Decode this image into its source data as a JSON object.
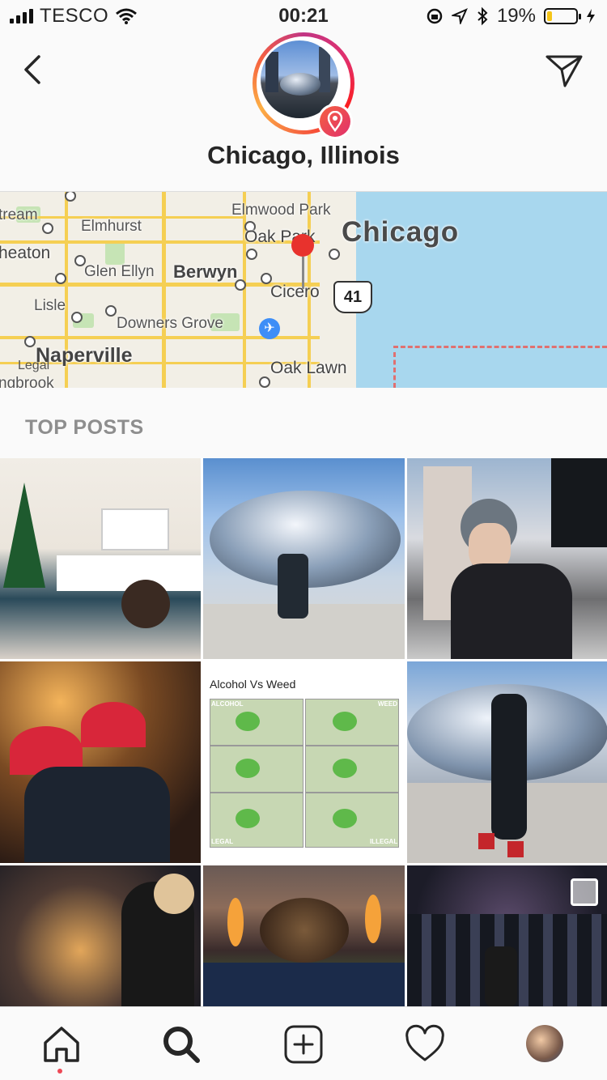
{
  "status_bar": {
    "carrier": "TESCO",
    "time": "00:21",
    "battery_percent": "19%",
    "battery_level": 0.19,
    "icons": [
      "signal-icon",
      "wifi-icon",
      "rotation-lock-icon",
      "location-arrow-icon",
      "bluetooth-icon",
      "battery-icon",
      "charging-icon"
    ]
  },
  "header": {
    "title": "Chicago, Illinois",
    "icons": [
      "back-chevron-icon",
      "send-direct-icon",
      "location-pin-icon"
    ]
  },
  "map": {
    "labels": {
      "city": "Chicago",
      "stream": "tream",
      "elmhurst": "Elmhurst",
      "elmwood_park": "Elmwood Park",
      "oak_park": "Oak Park",
      "wheaton": "heaton",
      "glen_ellyn": "Glen Ellyn",
      "berwyn": "Berwyn",
      "cicero": "Cicero",
      "lisle": "Lisle",
      "downers_grove": "Downers Grove",
      "naperville": "Naperville",
      "oak_lawn": "Oak Lawn",
      "bolingbrook": "ngbrook",
      "highway": "41",
      "legal": "Legal"
    }
  },
  "section": {
    "label": "TOP POSTS"
  },
  "posts": {
    "meme_caption": "Alcohol Vs Weed",
    "meme_alcohol": "ALCOHOL",
    "meme_weed": "WEED",
    "meme_legal": "LEGAL",
    "meme_illegal": "ILLEGAL"
  },
  "tabbar": {
    "items": [
      "home-icon",
      "search-icon",
      "add-post-icon",
      "activity-heart-icon",
      "profile-avatar"
    ]
  }
}
